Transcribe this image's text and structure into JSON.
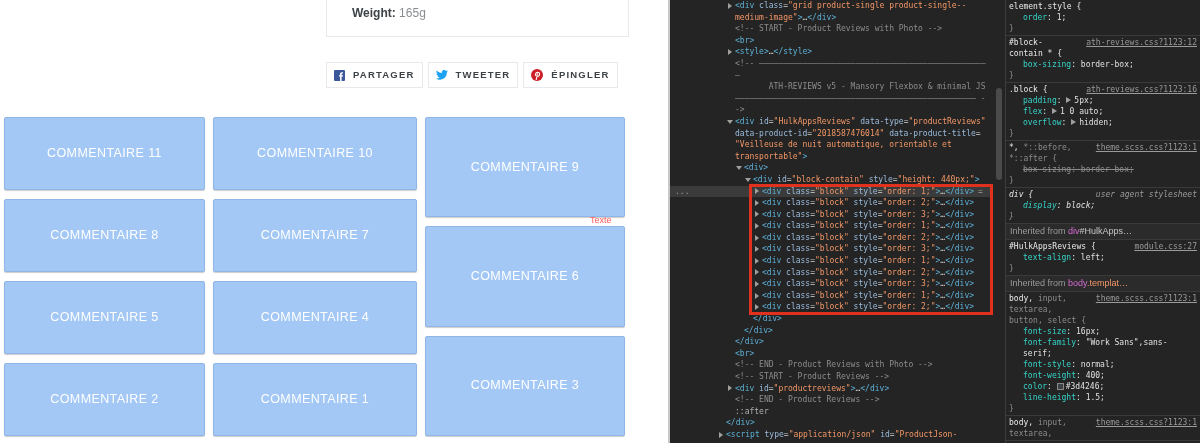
{
  "product_card": {
    "spec": "**Weight:** 165g"
  },
  "share_buttons": [
    {
      "kind": "facebook",
      "label": "PARTAGER"
    },
    {
      "kind": "twitter",
      "label": "TWEETER"
    },
    {
      "kind": "pinterest",
      "label": "ÉPINGLER"
    }
  ],
  "review_columns": [
    [
      "COMMENTAIRE 11",
      "COMMENTAIRE 8",
      "COMMENTAIRE 5",
      "COMMENTAIRE 2"
    ],
    [
      "COMMENTAIRE 10",
      "COMMENTAIRE 7",
      "COMMENTAIRE 4",
      "COMMENTAIRE 1"
    ],
    [
      "COMMENTAIRE 9",
      "COMMENTAIRE 6",
      "COMMENTAIRE 3"
    ]
  ],
  "overlay_label": "Texte",
  "elements": {
    "children": [
      {
        "kind": "tag",
        "text": "<div class=\"grid product-single product-single--medium-image\">…</div>",
        "expanded": false
      },
      {
        "kind": "comment",
        "text": "<!-- START - Product Reviews with Photo -->"
      },
      {
        "kind": "tag",
        "text": "<br>"
      },
      {
        "kind": "tag",
        "text": "<style>…</style>",
        "expanded": false
      },
      {
        "kind": "comment",
        "text": "<!-- ———————————————————————————————————————————————\n—\n       ATH-REVIEWS v5 - Mansory Flexbox & minimal JS\n—————————————————————————————————————————————————— -\n->"
      },
      {
        "kind": "tag",
        "text": "<div id=\"HulkAppsReviews\" data-type=\"productReviews\" data-product-id=\"2018587476014\" data-product-title=\"Veilleuse de nuit automatique, orientable et transportable\">",
        "expanded": true,
        "closing": "</div>",
        "children": [
          {
            "kind": "tag",
            "text": "<div>",
            "expanded": true,
            "closing": "</div>",
            "children": [
              {
                "kind": "tag",
                "text": "<div id=\"block-contain\" style=\"height: 440px;\">",
                "expanded": true,
                "annotated": true,
                "closing": "</div>",
                "children": [
                  {
                    "kind": "tag",
                    "text": "<div class=\"block\" style=\"order: 1;\">…</div>",
                    "expanded": false,
                    "selected": true,
                    "marker": "...",
                    "badge": "="
                  },
                  {
                    "kind": "tag",
                    "text": "<div class=\"block\" style=\"order: 2;\">…</div>",
                    "expanded": false,
                    "selected": false
                  },
                  {
                    "kind": "tag",
                    "text": "<div class=\"block\" style=\"order: 3;\">…</div>",
                    "expanded": false,
                    "selected": false
                  },
                  {
                    "kind": "tag",
                    "text": "<div class=\"block\" style=\"order: 1;\">…</div>",
                    "expanded": false,
                    "selected": false
                  },
                  {
                    "kind": "tag",
                    "text": "<div class=\"block\" style=\"order: 2;\">…</div>",
                    "expanded": false,
                    "selected": false
                  },
                  {
                    "kind": "tag",
                    "text": "<div class=\"block\" style=\"order: 3;\">…</div>",
                    "expanded": false,
                    "selected": false
                  },
                  {
                    "kind": "tag",
                    "text": "<div class=\"block\" style=\"order: 1;\">…</div>",
                    "expanded": false,
                    "selected": false
                  },
                  {
                    "kind": "tag",
                    "text": "<div class=\"block\" style=\"order: 2;\">…</div>",
                    "expanded": false,
                    "selected": false
                  },
                  {
                    "kind": "tag",
                    "text": "<div class=\"block\" style=\"order: 3;\">…</div>",
                    "expanded": false,
                    "selected": false
                  },
                  {
                    "kind": "tag",
                    "text": "<div class=\"block\" style=\"order: 1;\">…</div>",
                    "expanded": false,
                    "selected": false
                  },
                  {
                    "kind": "tag",
                    "text": "<div class=\"block\" style=\"order: 2;\">…</div>",
                    "expanded": false,
                    "selected": false
                  }
                ]
              }
            ]
          }
        ]
      },
      {
        "kind": "tag",
        "text": "<br>"
      },
      {
        "kind": "comment",
        "text": "<!-- END - Product Reviews with Photo -->"
      },
      {
        "kind": "comment",
        "text": "<!-- START - Product Reviews -->"
      },
      {
        "kind": "tag",
        "text": "<div id=\"productreviews\">…</div>",
        "expanded": false
      },
      {
        "kind": "comment",
        "text": "<!-- END - Product Reviews -->"
      },
      {
        "kind": "pseudo",
        "text": "::after"
      }
    ],
    "closing": "</div>",
    "next": [
      {
        "kind": "tag",
        "text": "<script type=\"application/json\" id=\"ProductJson-",
        "expanded": false
      }
    ]
  },
  "styles": [
    {
      "kind": "rule",
      "selector": [
        [
          {
            "text": "element.style {",
            "matched": true
          }
        ]
      ],
      "decls": [
        {
          "prop": "order",
          "colon": ":",
          "value": "1;"
        }
      ],
      "close": "}"
    },
    {
      "kind": "rule",
      "selector": [
        [
          {
            "text": "#block-",
            "matched": true
          }
        ],
        [
          {
            "text": "contain * {",
            "matched": true
          }
        ]
      ],
      "source": "ath-reviews.css?1123:12",
      "decls": [
        {
          "prop": "box-sizing",
          "colon": ":",
          "value": "border-box;"
        }
      ],
      "close": "}"
    },
    {
      "kind": "rule",
      "selector": [
        [
          {
            "text": ".block {",
            "matched": true
          }
        ]
      ],
      "source": "ath-reviews.css?1123:16",
      "decls": [
        {
          "prop": "padding",
          "colon": ":",
          "value": "5px;",
          "expandable": true
        },
        {
          "prop": "flex",
          "colon": ":",
          "value": "1 0 auto;",
          "expandable": true
        },
        {
          "prop": "overflow",
          "colon": ":",
          "value": "hidden;",
          "expandable": true
        }
      ],
      "close": "}"
    },
    {
      "kind": "rule",
      "selector": [
        [
          {
            "text": "*,",
            "matched": true
          },
          {
            "text": "*::before,",
            "matched": false
          }
        ],
        [
          {
            "text": "*::after {",
            "matched": false
          }
        ]
      ],
      "source": "theme.scss.css?1123:1",
      "decls": [
        {
          "prop": "box-sizing",
          "colon": ":",
          "value": "border-box;",
          "overridden": true
        }
      ],
      "close": "}"
    },
    {
      "kind": "user_agent",
      "selector": [
        [
          {
            "text": "div {",
            "matched": true
          }
        ]
      ],
      "source": "user agent stylesheet",
      "decls": [
        {
          "prop": "display",
          "colon": ":",
          "value": "block;"
        }
      ],
      "close": "}"
    },
    {
      "kind": "inherited",
      "lead": "Inherited from",
      "target": [
        {
          "text": "div",
          "kind": "tag"
        },
        {
          "text": "#HulkApps…",
          "kind": "id"
        }
      ]
    },
    {
      "kind": "rule",
      "selector": [
        [
          {
            "text": "#HulkAppsReviews {",
            "matched": true
          }
        ]
      ],
      "source": "module.css:27",
      "decls": [
        {
          "prop": "text-align",
          "colon": ":",
          "value": "left;"
        }
      ],
      "close": "}"
    },
    {
      "kind": "inherited",
      "lead": "Inherited from",
      "target": [
        {
          "text": "body",
          "kind": "tag"
        },
        {
          "text": ".templat…",
          "kind": "class"
        }
      ]
    },
    {
      "kind": "rule",
      "selector": [
        [
          {
            "text": "body,",
            "matched": true
          },
          {
            "text": "input,",
            "matched": false
          }
        ],
        [
          {
            "text": "textarea,",
            "matched": false
          }
        ],
        [
          {
            "text": "button, select {",
            "matched": false
          }
        ]
      ],
      "source": "theme.scss.css?1123:1",
      "decls": [
        {
          "prop": "font-size",
          "colon": ":",
          "value": "16px;"
        },
        {
          "prop": "font-family",
          "colon": ":",
          "value": "\"Work Sans\",sans-serif;"
        },
        {
          "prop": "font-style",
          "colon": ":",
          "value": "normal;"
        },
        {
          "prop": "font-weight",
          "colon": ":",
          "value": "400;"
        },
        {
          "prop": "color",
          "colon": ":",
          "value": "#3d4246;",
          "color": "#3d4246"
        },
        {
          "prop": "line-height",
          "colon": ":",
          "value": "1.5;"
        }
      ],
      "close": "}"
    },
    {
      "kind": "rule",
      "selector": [
        [
          {
            "text": "body,",
            "matched": true
          },
          {
            "text": "input,",
            "matched": false
          }
        ],
        [
          {
            "text": "textarea,",
            "matched": false
          }
        ]
      ],
      "source": "theme.scss.css?1123:1"
    }
  ]
}
